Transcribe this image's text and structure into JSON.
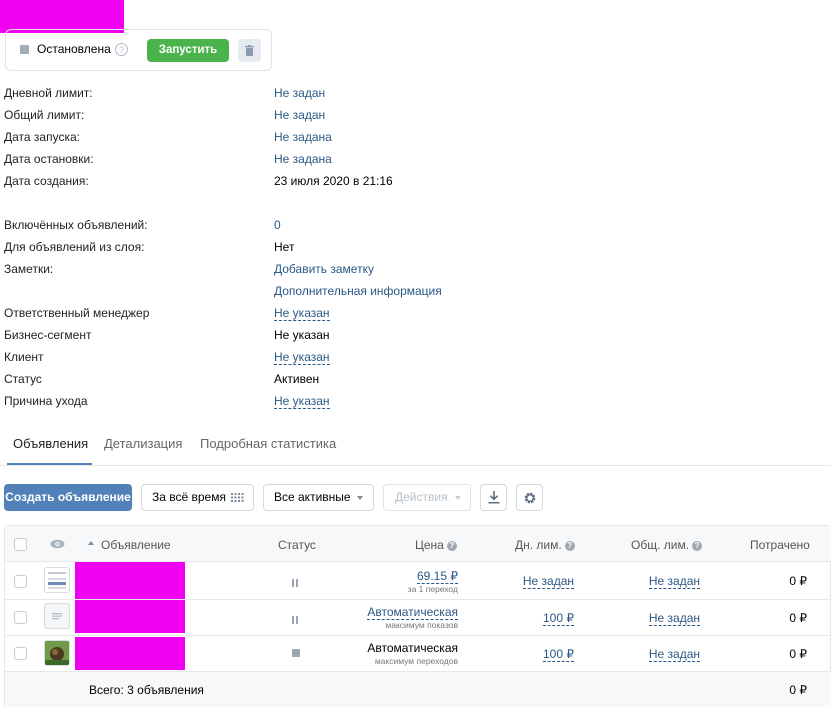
{
  "status_panel": {
    "status": "Остановлена",
    "help_glyph": "?",
    "start_button": "Запустить"
  },
  "info": [
    {
      "label": "Дневной лимит:",
      "value": "Не задан",
      "style": "link"
    },
    {
      "label": "Общий лимит:",
      "value": "Не задан",
      "style": "link"
    },
    {
      "label": "Дата запуска:",
      "value": "Не задана",
      "style": "link"
    },
    {
      "label": "Дата остановки:",
      "value": "Не задана",
      "style": "link"
    },
    {
      "label": "Дата создания:",
      "value": "23 июля 2020 в 21:16",
      "style": "plain"
    },
    {
      "label": "Включённых объявлений:",
      "value": "0",
      "style": "link"
    },
    {
      "label": "Для объявлений из слоя:",
      "value": "Нет",
      "style": "plain"
    },
    {
      "label": "Заметки:",
      "value": "Добавить заметку",
      "style": "link"
    },
    {
      "label": "",
      "value": "Дополнительная информация",
      "style": "link"
    },
    {
      "label": "Ответственный менеджер",
      "value": "Не указан",
      "style": "dash"
    },
    {
      "label": "Бизнес-сегмент",
      "value": "Не указан",
      "style": "plain"
    },
    {
      "label": "Клиент",
      "value": "Не указан",
      "style": "dash"
    },
    {
      "label": "Статус",
      "value": "Активен",
      "style": "plain"
    },
    {
      "label": "Причина ухода",
      "value": "Не указан",
      "style": "dash"
    }
  ],
  "tabs": [
    "Объявления",
    "Детализация",
    "Подробная статистика"
  ],
  "toolbar": {
    "create": "Создать объявление",
    "period": "За всё время",
    "filter": "Все активные",
    "actions": "Действия"
  },
  "table": {
    "headers": {
      "ad": "Объявление",
      "status": "Статус",
      "price": "Цена",
      "day_limit": "Дн. лим.",
      "total_limit": "Общ. лим.",
      "spent": "Потрачено"
    },
    "rows": [
      {
        "status": "paused",
        "price": "69.15 ₽",
        "price_sub": "за 1 переход",
        "day_limit": "Не задан",
        "total_limit": "Не задан",
        "spent": "0 ₽"
      },
      {
        "status": "paused",
        "price": "Автоматическая",
        "price_sub": "максимум показов",
        "day_limit": "100 ₽",
        "total_limit": "Не задан",
        "spent": "0 ₽"
      },
      {
        "status": "stopped",
        "price": "Автоматическая",
        "price_sub": "максимум переходов",
        "day_limit": "100 ₽",
        "total_limit": "Не задан",
        "spent": "0 ₽"
      }
    ],
    "footer": {
      "total": "Всего: 3 объявления",
      "spent": "0 ₽"
    }
  },
  "colors": {
    "accent": "#5181b8",
    "green": "#4bb34b",
    "link": "#2a5885",
    "redaction": "#f000f0"
  }
}
